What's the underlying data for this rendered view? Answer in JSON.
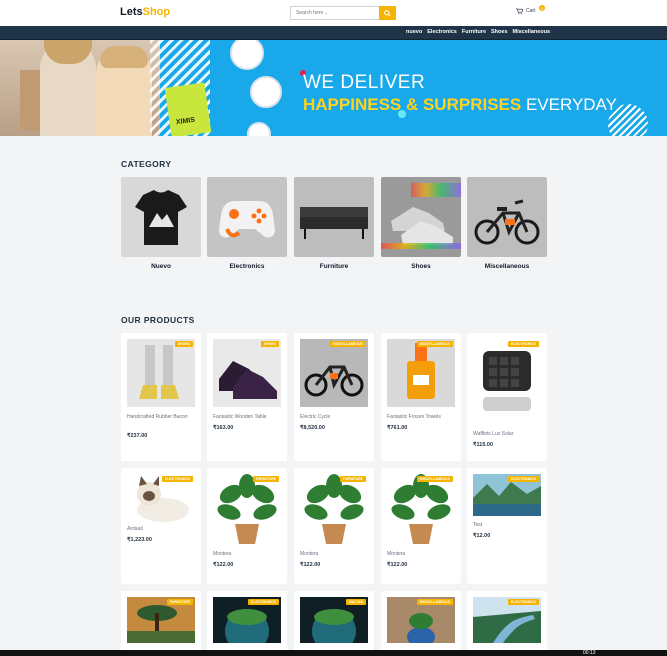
{
  "header": {
    "logo_main": "Lets",
    "logo_accent": "Shop",
    "search_placeholder": "Search here ...",
    "cart_label": "Cart",
    "cart_count": "0"
  },
  "nav": {
    "items": [
      "nuevo",
      "Electronics",
      "Furniture",
      "Shoes",
      "Miscellaneous"
    ]
  },
  "hero": {
    "line1": "WE DELIVER",
    "line2_highlight": "HAPPINESS & SURPRISES",
    "line2_rest": " EVERYDAY",
    "bag_label": "XIMIS"
  },
  "categories": {
    "title": "CATEGORY",
    "items": [
      {
        "label": "Nuevo",
        "icon": "tshirt"
      },
      {
        "label": "Electronics",
        "icon": "gamepad"
      },
      {
        "label": "Furniture",
        "icon": "sofa"
      },
      {
        "label": "Shoes",
        "icon": "sneakers"
      },
      {
        "label": "Miscellaneous",
        "icon": "bicycle"
      }
    ]
  },
  "products": {
    "title": "OUR PRODUCTS",
    "items": [
      {
        "badge": "SHOES",
        "name": "Handcrafted Rubber Bacon",
        "price": "₹237.00",
        "icon": "boots"
      },
      {
        "badge": "SHOES",
        "name": "Fantastic Wooden Table",
        "price": "₹163.00",
        "icon": "loafers"
      },
      {
        "badge": "MISCELLANEOUS",
        "name": "Electric Cycle",
        "price": "₹8,520.00",
        "icon": "ebike"
      },
      {
        "badge": "MISCELLANEOUS",
        "name": "Fantastic Frozen Towels",
        "price": "₹761.00",
        "icon": "perfume"
      },
      {
        "badge": "ELECTRONICS",
        "name": "Wafflets Lux Solar",
        "price": "₹115.00",
        "icon": "waffle-maker"
      },
      {
        "badge": "ELECTRONICS",
        "name": "Ardsad",
        "price": "₹1,223.00",
        "icon": "cat"
      },
      {
        "badge": "FURNITURE",
        "name": "Montera",
        "price": "₹122.00",
        "icon": "plant"
      },
      {
        "badge": "FURNITURE",
        "name": "Montera",
        "price": "₹122.00",
        "icon": "plant"
      },
      {
        "badge": "MISCELLANEOUS",
        "name": "Montera",
        "price": "₹122.00",
        "icon": "plant"
      },
      {
        "badge": "ELECTRONICS",
        "name": "Test",
        "price": "₹12.00",
        "icon": "landscape"
      },
      {
        "badge": "FURNITURE",
        "name": "",
        "price": "",
        "icon": "tree-landscape"
      },
      {
        "badge": "ELECTRONICS",
        "name": "",
        "price": "",
        "icon": "globe-island"
      },
      {
        "badge": "MALTAS",
        "name": "",
        "price": "",
        "icon": "globe-island"
      },
      {
        "badge": "MISCELLANEOUS",
        "name": "",
        "price": "",
        "icon": "blue-plant"
      },
      {
        "badge": "ELECTRONICS",
        "name": "",
        "price": "",
        "icon": "river"
      }
    ]
  },
  "taskbar": {
    "clock": "00:13"
  },
  "colors": {
    "accent": "#f5b400",
    "nav_bg": "#1f3448",
    "hero_bg": "#19a9ea"
  }
}
